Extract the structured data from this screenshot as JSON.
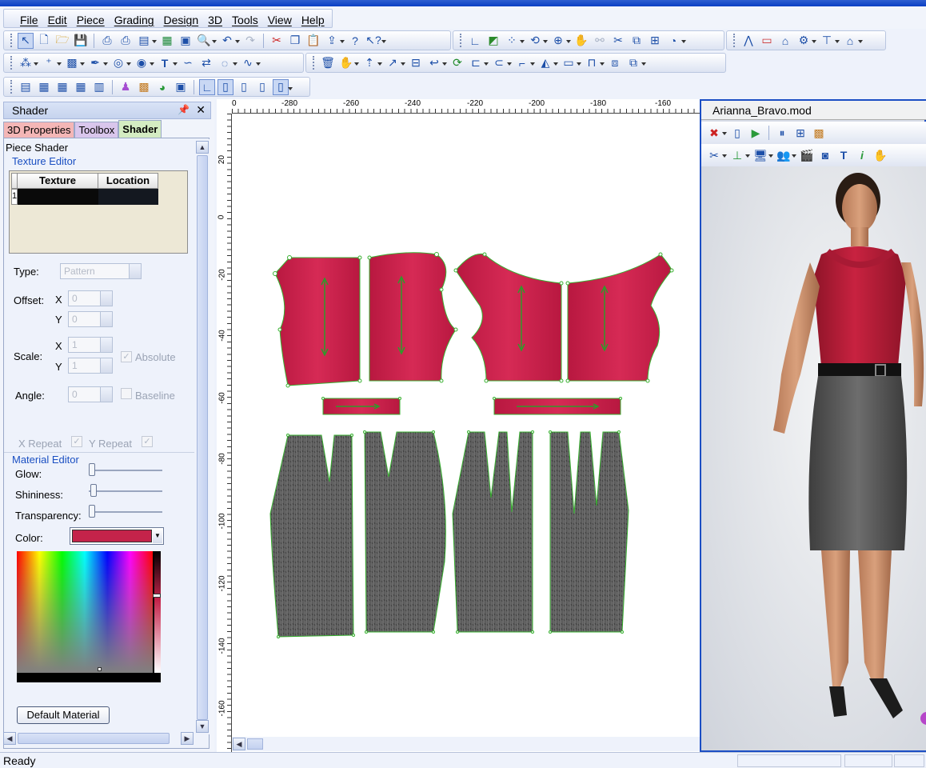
{
  "menu": [
    "File",
    "Edit",
    "Piece",
    "Grading",
    "Design",
    "3D",
    "Tools",
    "View",
    "Help"
  ],
  "panel": {
    "title": "Shader",
    "pin_icon": "pin-icon",
    "close_icon": "close-icon",
    "tabs": [
      {
        "label": "3D Properties",
        "color": "#f4b6b6"
      },
      {
        "label": "Toolbox",
        "color": "#d9c6ec"
      },
      {
        "label": "Shader",
        "color": "#d4ecc2"
      }
    ],
    "section": "Piece Shader",
    "texture_editor": "Texture Editor",
    "texture_columns": [
      "Texture",
      "Location"
    ],
    "texture_rows": [
      {
        "num": "1",
        "texture": "",
        "location": ""
      }
    ],
    "type_label": "Type:",
    "type_value": "Pattern",
    "offset_label": "Offset:",
    "offset_x_label": "X",
    "offset_x": "0",
    "offset_y_label": "Y",
    "offset_y": "0",
    "scale_label": "Scale:",
    "scale_x_label": "X",
    "scale_x": "1",
    "scale_y_label": "Y",
    "scale_y": "1",
    "absolute_label": "Absolute",
    "angle_label": "Angle:",
    "angle_value": "0",
    "baseline_label": "Baseline",
    "x_repeat_label": "X Repeat",
    "y_repeat_label": "Y Repeat",
    "material_editor": "Material Editor",
    "glow_label": "Glow:",
    "glow_value": 0.0,
    "shininess_label": "Shininess:",
    "shininess_value": 0.02,
    "transparency_label": "Transparency:",
    "transparency_value": 0.0,
    "color_label": "Color:",
    "color_value": "#c4234a",
    "default_material_button": "Default Material"
  },
  "ruler": {
    "top": [
      "0",
      "-280",
      "-260",
      "-240",
      "-220",
      "-200",
      "-180",
      "-160"
    ],
    "left": [
      "20",
      "0",
      "-20",
      "-40",
      "-60",
      "-80",
      "-100",
      "-120",
      "-140",
      "-160"
    ]
  },
  "pieces": {
    "bodice_color": "#c71f4a",
    "skirt_color": "#5a5a5a",
    "outline_color": "#38b030"
  },
  "viewer": {
    "title": "Arianna_Bravo.mod"
  },
  "status": {
    "text": "Ready"
  }
}
